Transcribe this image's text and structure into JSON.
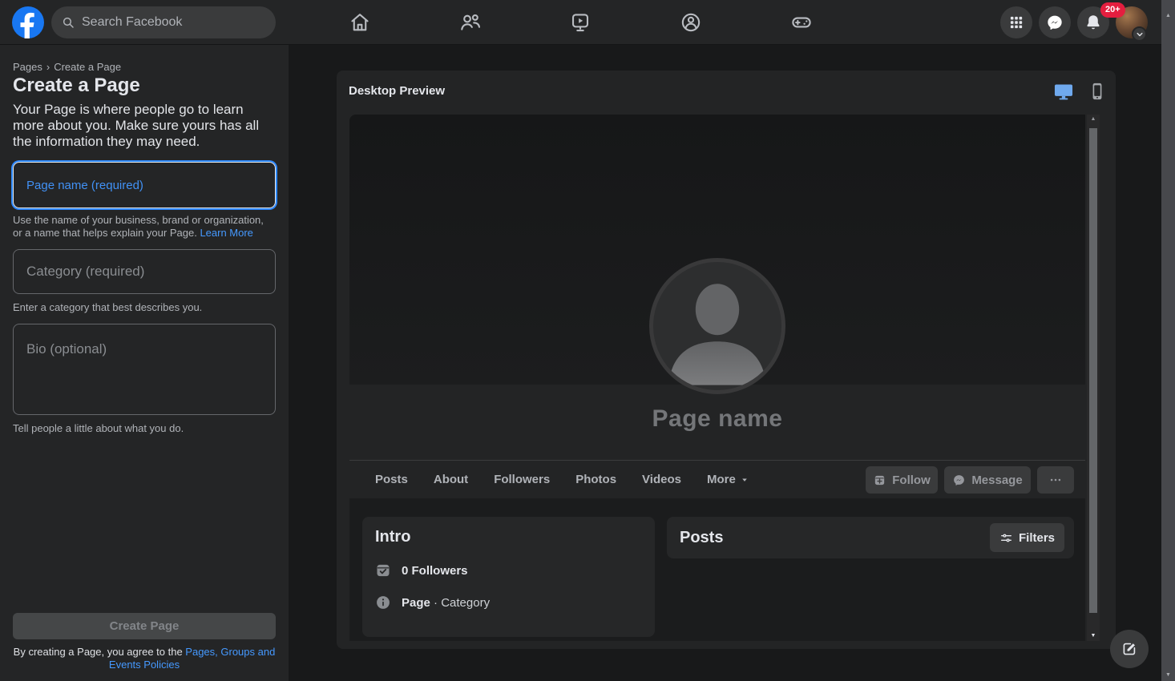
{
  "topbar": {
    "search_placeholder": "Search Facebook",
    "notification_count": "20+"
  },
  "sidebar": {
    "breadcrumb": {
      "root": "Pages",
      "separator": "›",
      "current": "Create a Page"
    },
    "title": "Create a Page",
    "description": "Your Page is where people go to learn more about you. Make sure yours has all the information they may need.",
    "page_name_field": {
      "placeholder": "Page name (required)",
      "helper": "Use the name of your business, brand or organization, or a name that helps explain your Page. ",
      "helper_link": "Learn More"
    },
    "category_field": {
      "placeholder": "Category (required)",
      "helper": "Enter a category that best describes you."
    },
    "bio_field": {
      "placeholder": "Bio (optional)",
      "helper": "Tell people a little about what you do."
    },
    "create_button_label": "Create Page",
    "policy_prefix": "By creating a Page, you agree to the ",
    "policy_link": "Pages, Groups and Events Policies"
  },
  "preview": {
    "panel_title": "Desktop Preview",
    "page_name_placeholder": "Page name",
    "tabs": [
      "Posts",
      "About",
      "Followers",
      "Photos",
      "Videos"
    ],
    "more_tab_label": "More",
    "actions": {
      "follow": "Follow",
      "message": "Message"
    },
    "intro": {
      "title": "Intro",
      "followers": "0 Followers",
      "page_word": "Page",
      "separator": "·",
      "category_word": "Category"
    },
    "posts": {
      "title": "Posts",
      "filters_label": "Filters"
    }
  },
  "icons": {
    "topbar": [
      "facebook-logo",
      "search-icon",
      "home-icon",
      "friends-icon",
      "watch-icon",
      "groups-icon",
      "gaming-icon",
      "apps-grid-icon",
      "messenger-icon",
      "bell-icon",
      "chevron-down-icon"
    ],
    "preview": [
      "desktop-icon",
      "mobile-icon",
      "person-silhouette-icon",
      "follow-plus-icon",
      "messenger-icon",
      "ellipsis-icon",
      "follower-check-icon",
      "info-icon",
      "filters-icon",
      "compose-icon"
    ]
  },
  "colors": {
    "brand_blue": "#1877f2",
    "link_blue": "#4599ff",
    "focus_ring_blue": "#2d88ff",
    "badge_red": "#e41e3f",
    "active_toggle_blue": "#6fa9ee",
    "topbar_bg": "#242526",
    "page_bg": "#18191a"
  }
}
